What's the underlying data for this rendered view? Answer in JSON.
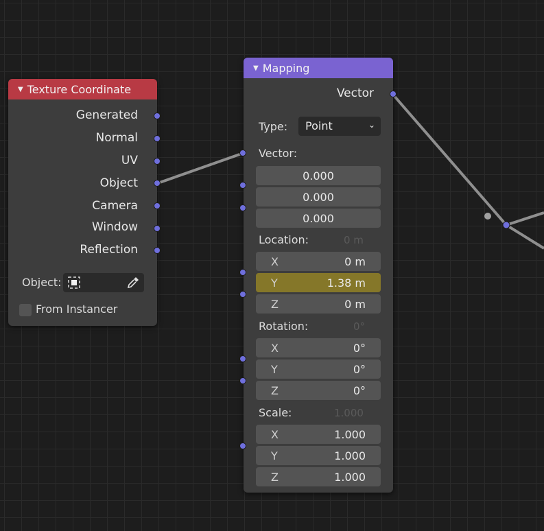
{
  "texture_node": {
    "title": "Texture Coordinate",
    "header_color": "#b83a44",
    "outputs": [
      "Generated",
      "Normal",
      "UV",
      "Object",
      "Camera",
      "Window",
      "Reflection"
    ],
    "object_label": "Object:",
    "object_icon": "object-cube-icon",
    "eyedropper_icon": "eyedropper-icon",
    "from_instancer_label": "From Instancer",
    "from_instancer_checked": false
  },
  "mapping_node": {
    "title": "Mapping",
    "header_color": "#7a63d1",
    "output": "Vector",
    "type_label": "Type:",
    "type_value": "Point",
    "vector_label": "Vector:",
    "vector_values": [
      "0.000",
      "0.000",
      "0.000"
    ],
    "location": {
      "label": "Location:",
      "ghost": "0 m",
      "x": {
        "axis": "X",
        "value": "0 m"
      },
      "y": {
        "axis": "Y",
        "value": "1.38 m",
        "highlighted": true
      },
      "z": {
        "axis": "Z",
        "value": "0 m"
      }
    },
    "rotation": {
      "label": "Rotation:",
      "ghost": "0°",
      "x": {
        "axis": "X",
        "value": "0°"
      },
      "y": {
        "axis": "Y",
        "value": "0°"
      },
      "z": {
        "axis": "Z",
        "value": "0°"
      }
    },
    "scale": {
      "label": "Scale:",
      "ghost": "1.000",
      "x": {
        "axis": "X",
        "value": "1.000"
      },
      "y": {
        "axis": "Y",
        "value": "1.000"
      },
      "z": {
        "axis": "Z",
        "value": "1.000"
      }
    }
  },
  "colors": {
    "socket_vector": "#6f6fdc",
    "socket_grey": "#a0a0a0",
    "highlight_field": "#857729",
    "link": "#9a9a9a"
  }
}
